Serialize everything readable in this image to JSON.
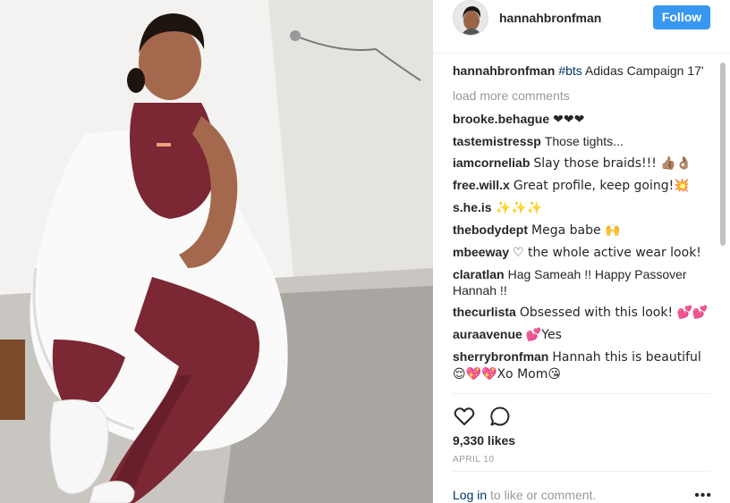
{
  "post": {
    "author": "hannahbronfman",
    "follow_label": "Follow",
    "caption": {
      "username": "hannahbronfman",
      "hashtag": "#bts",
      "text": " Adidas Campaign 17'"
    },
    "load_more": "load more comments",
    "comments": [
      {
        "user": "brooke.behague",
        "text": "❤❤❤"
      },
      {
        "user": "tastemistressp",
        "text": "Those tights..."
      },
      {
        "user": "iamcorneliab",
        "text": "Slay those braids!!! 👍🏽👌🏽"
      },
      {
        "user": "free.will.x",
        "text": "Great profile, keep going!💥"
      },
      {
        "user": "s.he.is",
        "text": "✨✨✨"
      },
      {
        "user": "thebodydept",
        "text": "Mega babe 🙌"
      },
      {
        "user": "mbeeway",
        "text": "♡ the whole active wear look!"
      },
      {
        "user": "claratlan",
        "text": "Hag Sameah !! Happy Passover Hannah !!"
      },
      {
        "user": "thecurlista",
        "text": "Obsessed with this look! 💕💕"
      },
      {
        "user": "auraavenue",
        "text": "💕Yes"
      },
      {
        "user": "sherrybronfman",
        "text": "Hannah this is beautiful 😌💖💖Xo Mom😘"
      }
    ],
    "likes": "9,330 likes",
    "date": "APRIL 10",
    "footer": {
      "login_link": "Log in",
      "login_text": " to like or comment.",
      "more": "•••"
    }
  },
  "icons": {
    "like": "heart-outline-icon",
    "comment": "comment-bubble-icon",
    "more": "more-options-icon"
  },
  "colors": {
    "follow_button": "#3897f0",
    "link": "#003569",
    "muted": "#999999",
    "text": "#262626"
  }
}
